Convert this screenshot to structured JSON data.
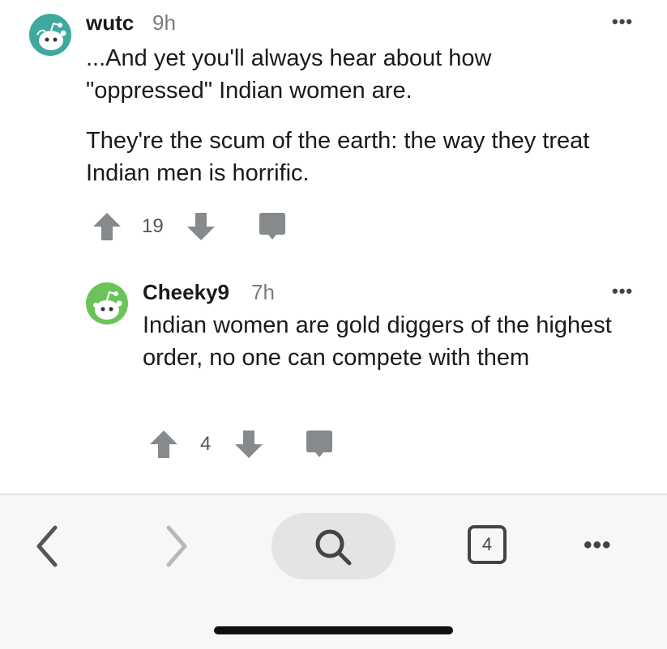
{
  "comments": [
    {
      "username": "wutc",
      "age": "9h",
      "paragraphs": [
        "...And yet you'll always hear about how \"oppressed\" Indian women are.",
        "They're the scum of the earth: the way they treat Indian men is horrific."
      ],
      "vote_count": "19",
      "avatar_color": "#3fa9a0",
      "avatar_icon": "snoo-avatar-icon"
    },
    {
      "username": "Cheeky9",
      "age": "7h",
      "paragraphs": [
        "Indian women are gold diggers of the highest order, no one can compete with them"
      ],
      "vote_count": "4",
      "avatar_color": "#6bc45a",
      "avatar_icon": "snoo-avatar-icon"
    }
  ],
  "more_options": "•••",
  "toolbar": {
    "back_icon": "chevron-left-icon",
    "forward_icon": "chevron-right-icon",
    "search_icon": "search-icon",
    "tab_count": "4",
    "menu_dots": "•••"
  },
  "colors": {
    "icon_gray": "#878a8c",
    "text": "#1a1a1b",
    "meta": "#787c7e"
  }
}
